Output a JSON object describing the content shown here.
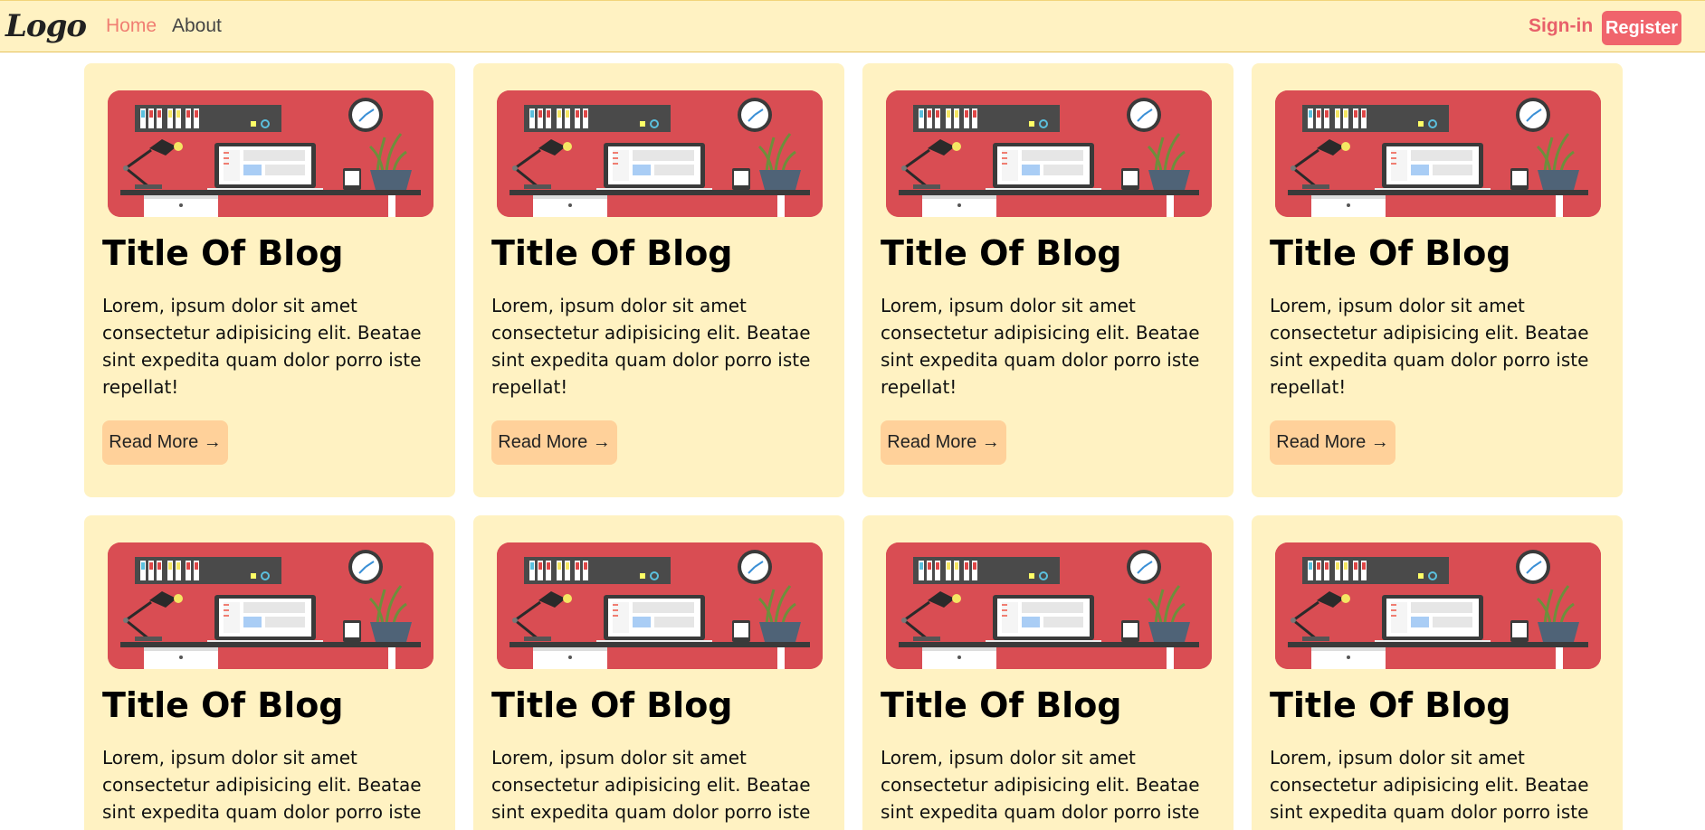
{
  "nav": {
    "logo": "Logo",
    "links": [
      "Home",
      "About"
    ],
    "signin": "Sign-in",
    "register": "Register"
  },
  "colors": {
    "navbar_bg": "#fff2c2",
    "card_bg": "#fff2c2",
    "accent": "#f0646c",
    "button_bg": "#ffd19a"
  },
  "cards": [
    {
      "title": "Title Of Blog",
      "body": "Lorem, ipsum dolor sit amet consectetur adipisicing elit. Beatae sint expedita quam dolor porro iste repellat!",
      "button": "Read More →"
    },
    {
      "title": "Title Of Blog",
      "body": "Lorem, ipsum dolor sit amet consectetur adipisicing elit. Beatae sint expedita quam dolor porro iste repellat!",
      "button": "Read More →"
    },
    {
      "title": "Title Of Blog",
      "body": "Lorem, ipsum dolor sit amet consectetur adipisicing elit. Beatae sint expedita quam dolor porro iste repellat!",
      "button": "Read More →"
    },
    {
      "title": "Title Of Blog",
      "body": "Lorem, ipsum dolor sit amet consectetur adipisicing elit. Beatae sint expedita quam dolor porro iste repellat!",
      "button": "Read More →"
    },
    {
      "title": "Title Of Blog",
      "body": "Lorem, ipsum dolor sit amet consectetur adipisicing elit. Beatae sint expedita quam dolor porro iste"
    },
    {
      "title": "Title Of Blog",
      "body": "Lorem, ipsum dolor sit amet consectetur adipisicing elit. Beatae sint expedita quam dolor porro iste"
    },
    {
      "title": "Title Of Blog",
      "body": "Lorem, ipsum dolor sit amet consectetur adipisicing elit. Beatae sint expedita quam dolor porro iste"
    },
    {
      "title": "Title Of Blog",
      "body": "Lorem, ipsum dolor sit amet consectetur adipisicing elit. Beatae sint expedita quam dolor porro iste"
    }
  ]
}
